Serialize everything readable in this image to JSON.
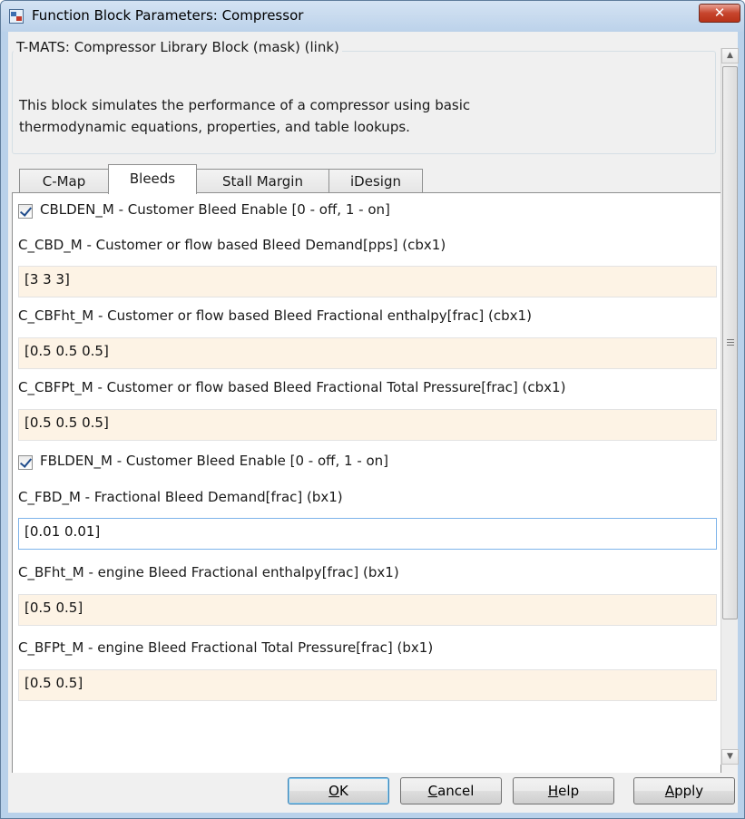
{
  "window": {
    "title": "Function Block Parameters: Compressor",
    "close_glyph": "✕"
  },
  "mask": {
    "group_title": "T-MATS: Compressor Library Block (mask) (link)",
    "description_line1": "This block simulates the performance of a compressor using basic",
    "description_line2": "thermodynamic equations, properties, and table lookups."
  },
  "tabs": [
    {
      "label": "C-Map",
      "active": false
    },
    {
      "label": "Bleeds",
      "active": true
    },
    {
      "label": "Stall Margin",
      "active": false
    },
    {
      "label": "iDesign",
      "active": false
    }
  ],
  "params": {
    "cbld_enable": {
      "label": "CBLDEN_M - Customer Bleed Enable [0 - off, 1 - on]",
      "checked": true
    },
    "c_cbd": {
      "label": "C_CBD_M - Customer or flow based Bleed Demand[pps] (cbx1)",
      "value": "[3 3 3]"
    },
    "c_cbfht": {
      "label": "C_CBFht_M - Customer or flow based Bleed Fractional enthalpy[frac] (cbx1)",
      "value": "[0.5 0.5 0.5]"
    },
    "c_cbfpt": {
      "label": "C_CBFPt_M - Customer or flow based Bleed Fractional Total Pressure[frac] (cbx1)",
      "value": "[0.5 0.5 0.5]"
    },
    "fbld_enable": {
      "label": "FBLDEN_M - Customer Bleed Enable [0 - off, 1 - on]",
      "checked": true
    },
    "c_fbd": {
      "label": "C_FBD_M - Fractional Bleed Demand[frac] (bx1)",
      "value": "[0.01 0.01]"
    },
    "c_bfht": {
      "label": "C_BFht_M - engine Bleed Fractional enthalpy[frac] (bx1)",
      "value": "[0.5 0.5]"
    },
    "c_bfpt": {
      "label": "C_BFPt_M - engine Bleed Fractional Total Pressure[frac] (bx1)",
      "value": "[0.5 0.5]"
    }
  },
  "buttons": {
    "ok_mnemonic": "O",
    "ok_rest": "K",
    "cancel_mnemonic": "C",
    "cancel_rest": "ancel",
    "help_mnemonic": "H",
    "help_rest": "elp",
    "apply_mnemonic": "A",
    "apply_rest": "pply"
  },
  "colors": {
    "field_bg": "#fdf3e5",
    "focus_border": "#7eb4ea",
    "close_red": "#c7452d"
  }
}
